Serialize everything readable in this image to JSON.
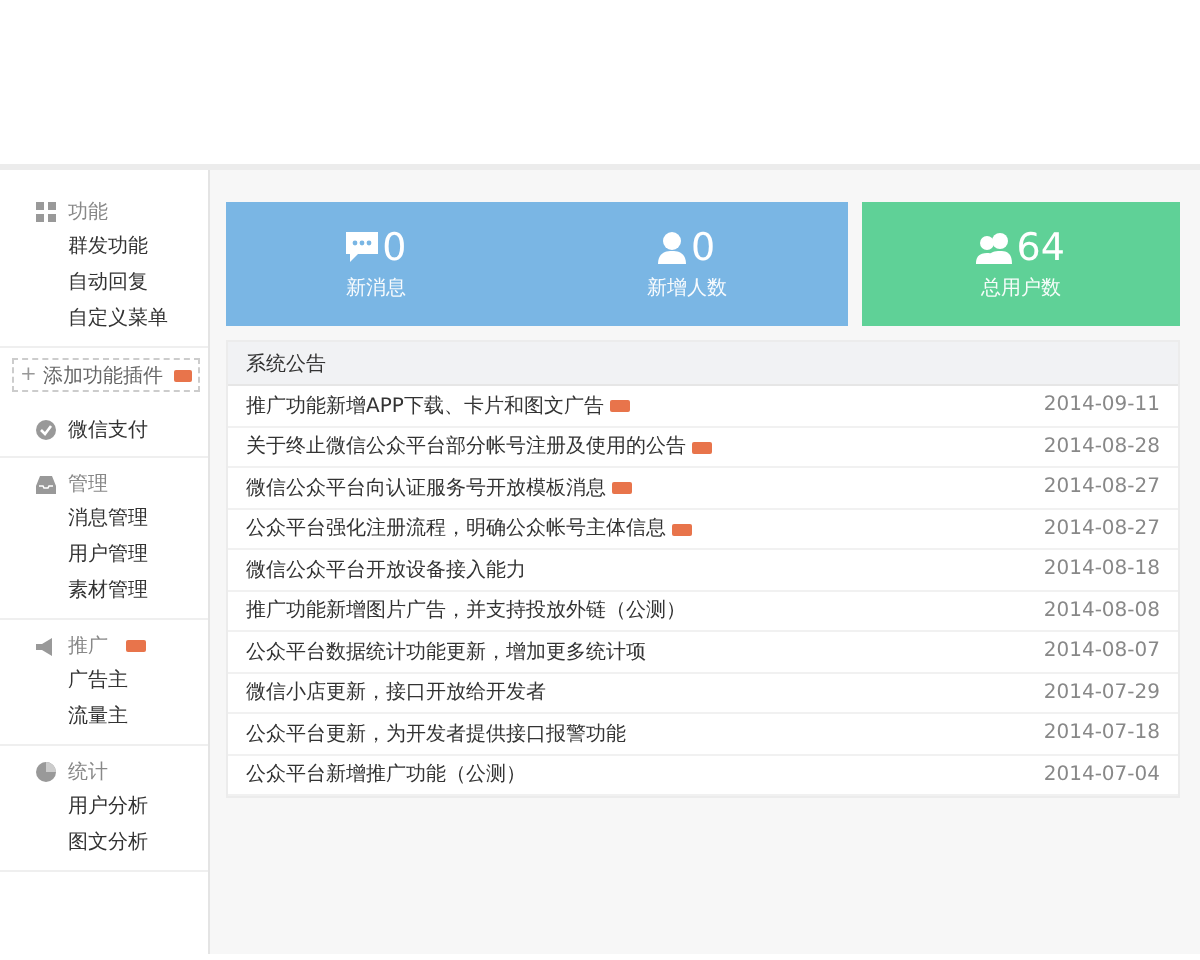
{
  "sidebar": {
    "sections": [
      {
        "kind": "group",
        "title": "功能",
        "new": false,
        "items": [
          {
            "label": "群发功能"
          },
          {
            "label": "自动回复"
          },
          {
            "label": "自定义菜单"
          }
        ]
      },
      {
        "kind": "button",
        "icon": "+",
        "label": "添加功能插件",
        "new": true
      },
      {
        "kind": "group",
        "title": "微信支付",
        "new": false
      },
      {
        "kind": "group",
        "title": "管理",
        "new": false,
        "items": [
          {
            "label": "消息管理"
          },
          {
            "label": "用户管理"
          },
          {
            "label": "素材管理"
          }
        ]
      },
      {
        "kind": "group",
        "title": "推广",
        "new": true,
        "items": [
          {
            "label": "广告主"
          },
          {
            "label": "流量主"
          }
        ]
      },
      {
        "kind": "group",
        "title": "统计",
        "new": false,
        "items": [
          {
            "label": "用户分析"
          },
          {
            "label": "图文分析"
          }
        ]
      }
    ]
  },
  "stats": [
    {
      "value": "0",
      "label": "新消息",
      "color": "#7ab6e4"
    },
    {
      "value": "0",
      "label": "新增人数",
      "color": "#7ab6e4"
    },
    {
      "value": "64",
      "label": "总用户数",
      "color": "#5fd197"
    }
  ],
  "announcements": {
    "title": "系统公告",
    "rows": [
      {
        "text": "推广功能新增APP下载、卡片和图文广告",
        "new": true,
        "date": "2014-09-11"
      },
      {
        "text": "关于终止微信公众平台部分帐号注册及使用的公告",
        "new": true,
        "date": "2014-08-28"
      },
      {
        "text": "微信公众平台向认证服务号开放模板消息",
        "new": true,
        "date": "2014-08-27"
      },
      {
        "text": "公众平台强化注册流程，明确公众帐号主体信息",
        "new": true,
        "date": "2014-08-27"
      },
      {
        "text": "微信公众平台开放设备接入能力",
        "new": false,
        "date": "2014-08-18"
      },
      {
        "text": "推广功能新增图片广告，并支持投放外链（公测）",
        "new": false,
        "date": "2014-08-08"
      },
      {
        "text": "公众平台数据统计功能更新，增加更多统计项",
        "new": false,
        "date": "2014-08-07"
      },
      {
        "text": "微信小店更新，接口开放给开发者",
        "new": false,
        "date": "2014-07-29"
      },
      {
        "text": "公众平台更新，为开发者提供接口报警功能",
        "new": false,
        "date": "2014-07-18"
      },
      {
        "text": "公众平台新增推广功能（公测）",
        "new": false,
        "date": "2014-07-04"
      }
    ]
  }
}
